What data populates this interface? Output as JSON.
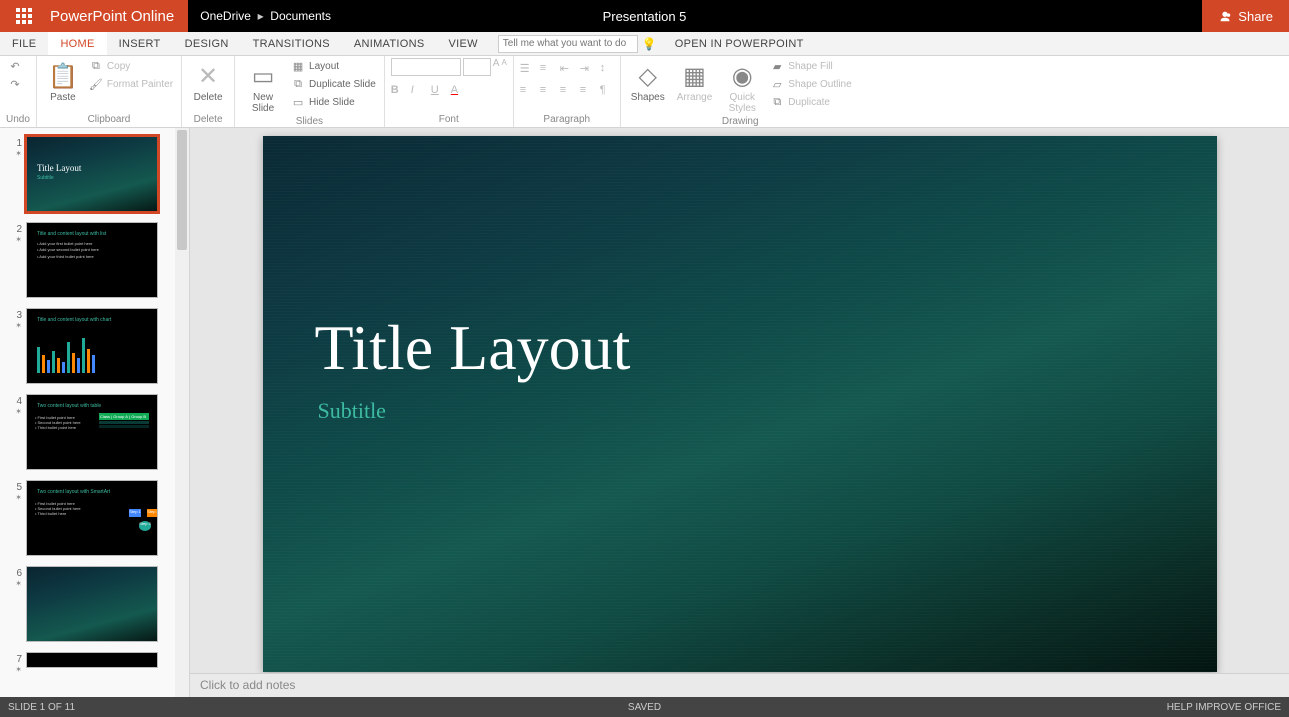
{
  "app": {
    "name": "PowerPoint Online"
  },
  "breadcrumb": {
    "root": "OneDrive",
    "folder": "Documents"
  },
  "document": {
    "title": "Presentation 5"
  },
  "share": {
    "label": "Share"
  },
  "tabs": {
    "file": "FILE",
    "home": "HOME",
    "insert": "INSERT",
    "design": "DESIGN",
    "transitions": "TRANSITIONS",
    "animations": "ANIMATIONS",
    "view": "VIEW",
    "tellme_placeholder": "Tell me what you want to do",
    "open_in_pp": "OPEN IN POWERPOINT"
  },
  "ribbon": {
    "undo": {
      "label": "Undo"
    },
    "clipboard": {
      "label": "Clipboard",
      "paste": "Paste",
      "copy": "Copy",
      "format_painter": "Format Painter"
    },
    "delete": {
      "label": "Delete",
      "btn": "Delete"
    },
    "slides": {
      "label": "Slides",
      "new_slide": "New Slide",
      "layout": "Layout",
      "duplicate": "Duplicate Slide",
      "hide": "Hide Slide"
    },
    "font": {
      "label": "Font"
    },
    "paragraph": {
      "label": "Paragraph"
    },
    "drawing": {
      "label": "Drawing",
      "shapes": "Shapes",
      "arrange": "Arrange",
      "quick_styles": "Quick Styles",
      "shape_fill": "Shape Fill",
      "shape_outline": "Shape Outline",
      "duplicate": "Duplicate"
    }
  },
  "slides_panel": {
    "items": [
      {
        "num": "1",
        "title": "Title Layout",
        "subtitle": "Subtitle"
      },
      {
        "num": "2",
        "title": "Title and content layout with list"
      },
      {
        "num": "3",
        "title": "Title and content layout with chart"
      },
      {
        "num": "4",
        "title": "Two content layout with table"
      },
      {
        "num": "5",
        "title": "Two content layout with SmartArt"
      },
      {
        "num": "6",
        "title": ""
      },
      {
        "num": "7",
        "title": ""
      }
    ]
  },
  "slide": {
    "title": "Title Layout",
    "subtitle": "Subtitle"
  },
  "notes": {
    "placeholder": "Click to add notes"
  },
  "status": {
    "left": "SLIDE 1 OF 11",
    "center": "SAVED",
    "right": "HELP IMPROVE OFFICE"
  }
}
